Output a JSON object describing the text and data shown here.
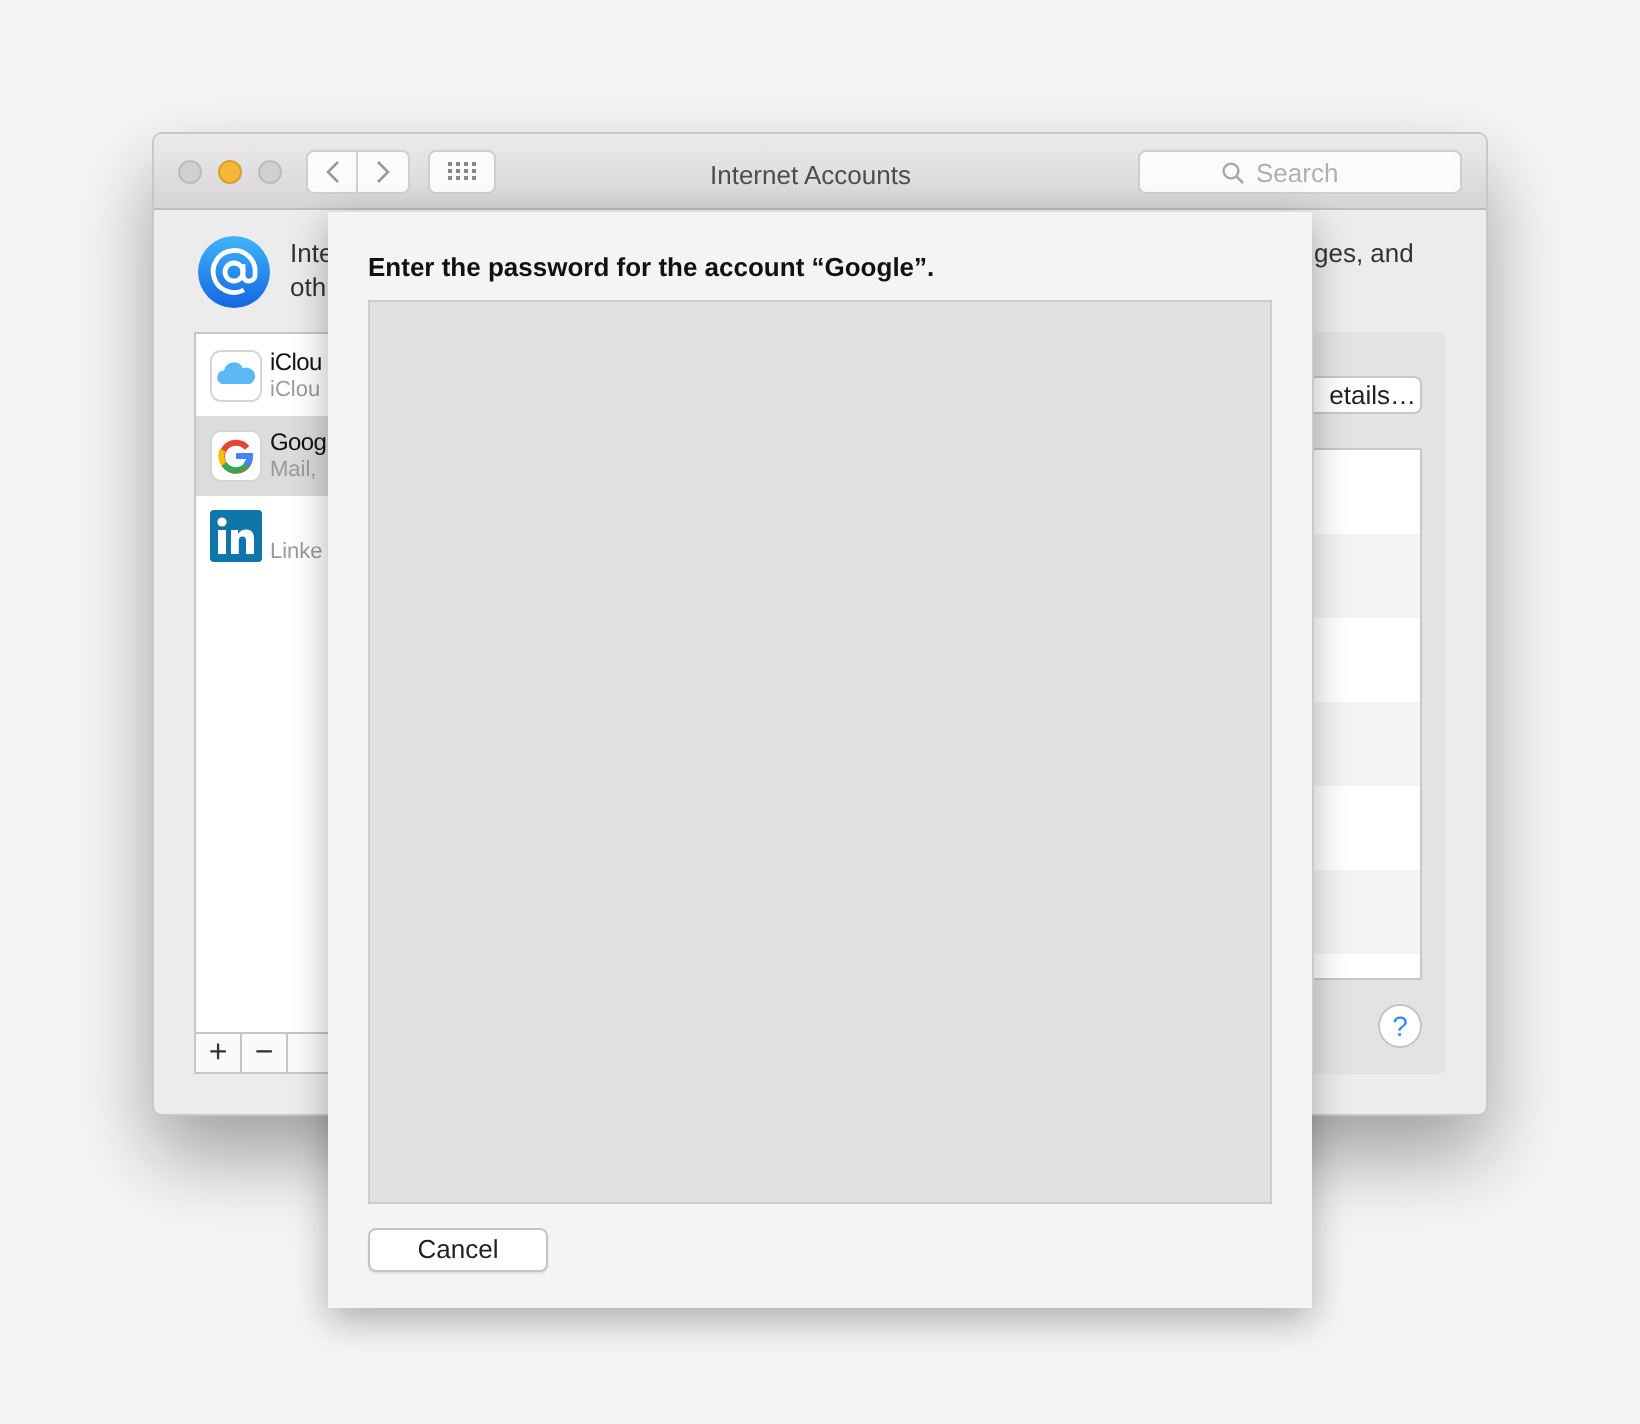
{
  "window": {
    "title": "Internet Accounts",
    "search": {
      "placeholder": "Search"
    }
  },
  "description": {
    "line_1_start": "Inte",
    "line_2_start": "oth",
    "line_1_end": "ges, and"
  },
  "accounts": [
    {
      "kind": "icloud",
      "name": "iClou",
      "detail": "iClou",
      "selected": false
    },
    {
      "kind": "google",
      "name": "Goog",
      "detail": "Mail, ",
      "selected": true
    },
    {
      "kind": "linkedin",
      "detail": "Linke",
      "selected": false
    }
  ],
  "list_buttons": [
    "+",
    "−"
  ],
  "details_button": "etails…",
  "help_button": "?",
  "sheet": {
    "title": "Enter the password for the account “Google”.",
    "cancel_button": "Cancel"
  }
}
